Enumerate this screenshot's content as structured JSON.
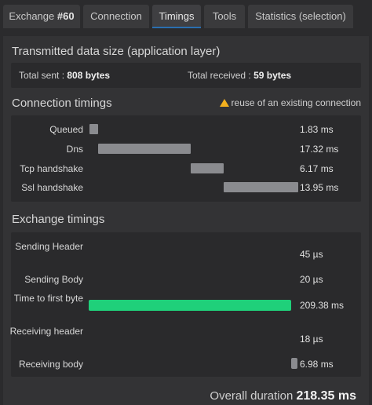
{
  "tabs": [
    {
      "label": "Exchange ",
      "label_strong": "#60"
    },
    {
      "label": "Connection"
    },
    {
      "label": "Timings",
      "active": true
    },
    {
      "label": "Tools"
    },
    {
      "label": "Statistics (selection)"
    }
  ],
  "transmitted": {
    "title": "Transmitted data size (application layer)",
    "sent_label": "Total sent :",
    "sent_value": "808 bytes",
    "received_label": "Total received :",
    "received_value": "59 bytes"
  },
  "connection": {
    "title": "Connection timings",
    "warning": "reuse of an existing connection",
    "rows": [
      {
        "label": "Queued",
        "value": "1.83 ms"
      },
      {
        "label": "Dns",
        "value": "17.32 ms"
      },
      {
        "label": "Tcp handshake",
        "value": "6.17 ms"
      },
      {
        "label": "Ssl handshake",
        "value": "13.95 ms"
      }
    ]
  },
  "exchange": {
    "title": "Exchange timings",
    "rows": [
      {
        "label": "Sending Header",
        "value": "45 µs"
      },
      {
        "label": "Sending Body",
        "value": "20 µs"
      },
      {
        "label": "Time to first byte",
        "value": "209.38 ms"
      },
      {
        "label": "Receiving header",
        "value": "18 µs"
      },
      {
        "label": "Receiving body",
        "value": "6.98 ms"
      }
    ]
  },
  "overall": {
    "label": "Overall duration",
    "value": "218.35 ms"
  },
  "colors": {
    "bar": "#8a8b8f",
    "ttfb_bar": "#1fd07a",
    "warning": "#f2b01e",
    "active_tab_underline": "#2a6fb0"
  }
}
